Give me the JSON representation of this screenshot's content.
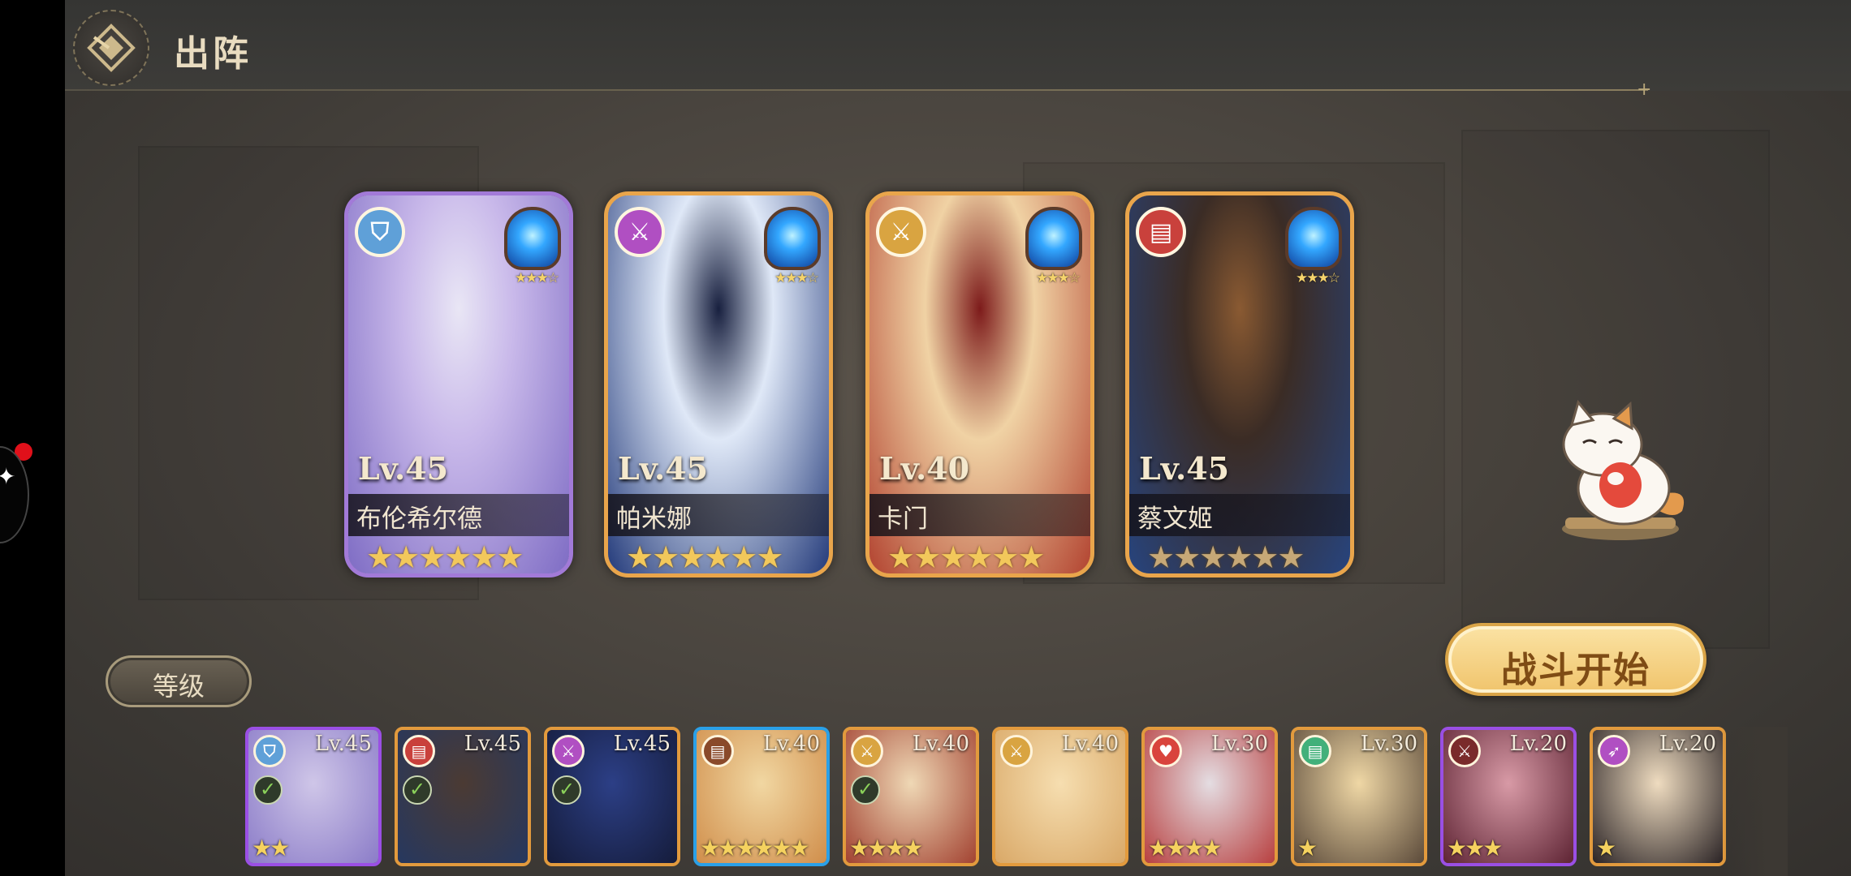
{
  "header": {
    "title": "出阵"
  },
  "team": [
    {
      "name": "布伦希尔德",
      "level": "Lv.45",
      "class_icon": "shield-icon",
      "class_color": "#5fa0d8",
      "gem_stars": "★★★☆",
      "stars": "★★★★★★",
      "border": "purple",
      "palette": [
        "#c9b9ea",
        "#7e6cc4",
        "#e9e6f5"
      ]
    },
    {
      "name": "帕米娜",
      "level": "Lv.45",
      "class_icon": "crossed-swords-icon",
      "class_color": "#b04fc2",
      "gem_stars": "★★★☆",
      "stars": "★★★★★★",
      "border": "gold",
      "palette": [
        "#dfe8f7",
        "#233a7a",
        "#18203f"
      ]
    },
    {
      "name": "卡门",
      "level": "Lv.40",
      "class_icon": "crossed-swords-icon",
      "class_color": "#d9a441",
      "gem_stars": "★★★☆",
      "stars": "★★★★★★",
      "border": "gold",
      "palette": [
        "#f0d2a4",
        "#b24330",
        "#7d1b1b"
      ]
    },
    {
      "name": "蔡文姬",
      "level": "Lv.45",
      "class_icon": "book-icon",
      "class_color": "#c9413c",
      "gem_stars": "★★★☆",
      "stars": "★★★★★★",
      "border": "gold",
      "palette": [
        "#3b2c25",
        "#27447e",
        "#8a5a32"
      ]
    }
  ],
  "sort": {
    "label": "等级"
  },
  "start": {
    "label": "战斗开始"
  },
  "roster": [
    {
      "level": "Lv.45",
      "class_icon": "shield-icon",
      "class_color": "#5fa0d8",
      "selected": true,
      "stars": "★★",
      "border": "purple",
      "palette": [
        "#cfc6e8",
        "#8b7cc8"
      ]
    },
    {
      "level": "Lv.45",
      "class_icon": "book-icon",
      "class_color": "#c9413c",
      "selected": true,
      "stars": "",
      "border": "gold",
      "palette": [
        "#4b3a33",
        "#26385f"
      ]
    },
    {
      "level": "Lv.45",
      "class_icon": "crossed-swords-icon",
      "class_color": "#b04fc2",
      "selected": true,
      "stars": "",
      "border": "gold",
      "palette": [
        "#2c3f86",
        "#151c3b"
      ]
    },
    {
      "level": "Lv.40",
      "class_icon": "book-icon",
      "class_color": "#8a4a2a",
      "selected": false,
      "stars": "★★★★★★",
      "border": "blue",
      "palette": [
        "#f1d7a2",
        "#d08e4b"
      ]
    },
    {
      "level": "Lv.40",
      "class_icon": "crossed-swords-icon",
      "class_color": "#d9a441",
      "selected": true,
      "stars": "★★★★",
      "border": "gold",
      "palette": [
        "#efd8b5",
        "#a24231"
      ]
    },
    {
      "level": "Lv.40",
      "class_icon": "crossed-swords-icon",
      "class_color": "#d9a441",
      "selected": false,
      "stars": "",
      "border": "gold",
      "palette": [
        "#f6deb0",
        "#d9a867"
      ]
    },
    {
      "level": "Lv.30",
      "class_icon": "heart-icon",
      "class_color": "#d9443c",
      "selected": false,
      "stars": "★★★★",
      "border": "gold",
      "palette": [
        "#e4dde2",
        "#b84040"
      ]
    },
    {
      "level": "Lv.30",
      "class_icon": "book-icon",
      "class_color": "#42b07a",
      "selected": false,
      "stars": "★",
      "border": "gold",
      "palette": [
        "#efd7a5",
        "#5b4a3a"
      ]
    },
    {
      "level": "Lv.20",
      "class_icon": "crossed-swords-icon",
      "class_color": "#7a2b2b",
      "selected": false,
      "stars": "★★★",
      "border": "purple",
      "palette": [
        "#d89aa6",
        "#5e2434"
      ]
    },
    {
      "level": "Lv.20",
      "class_icon": "bow-icon",
      "class_color": "#b04fc2",
      "selected": false,
      "stars": "★",
      "border": "gold",
      "palette": [
        "#efdcc0",
        "#2a2325"
      ]
    }
  ]
}
